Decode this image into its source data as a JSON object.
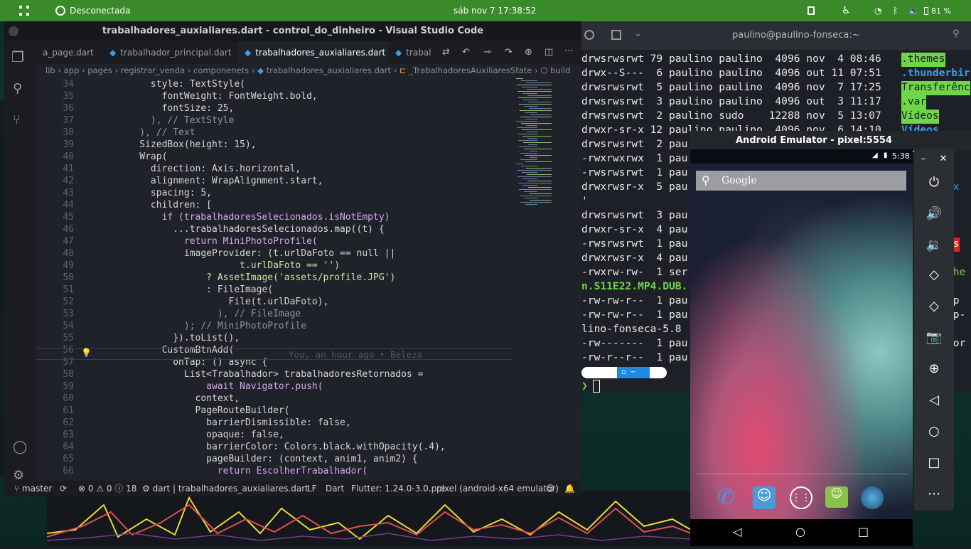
{
  "topbar": {
    "network": "Desconectada",
    "clock": "sáb nov 7  17:38:52",
    "battery": "81 %"
  },
  "vscode": {
    "title": "trabalhadores_auxialiares.dart - control_do_dinheiro - Visual Studio Code",
    "tabs": [
      {
        "label": "a_page.dart"
      },
      {
        "label": "trabalhador_principal.dart"
      },
      {
        "label": "trabalhadores_auxialiares.dart",
        "close": "×"
      },
      {
        "label": "trabal"
      }
    ],
    "breadcrumb": [
      "lib",
      "app",
      "pages",
      "registrar_venda",
      "componenets",
      "trabalhadores_auxialiares.dart",
      "_TrabalhadoresAuxiliaresState",
      "build"
    ],
    "blame": "You, an hour ago • Beleza",
    "status": {
      "branch": "master",
      "problems": "⊗ 0 ⚠ 0 ⓘ 18",
      "lang_file": "dart | trabalhadores_auxialiares.dart",
      "eol": "LF",
      "language": "Dart",
      "flutter": "Flutter: 1.24.0-3.0.pre",
      "device": "pixel (android-x64 emulator)"
    }
  },
  "code_lines": [
    {
      "n": "34",
      "t": "            style: TextStyle("
    },
    {
      "n": "35",
      "t": "              fontWeight: FontWeight.bold,"
    },
    {
      "n": "36",
      "t": "              fontSize: 25,"
    },
    {
      "n": "37",
      "t": "            ), // TextStyle"
    },
    {
      "n": "38",
      "t": "          ), // Text"
    },
    {
      "n": "39",
      "t": "          SizedBox(height: 15),"
    },
    {
      "n": "40",
      "t": "          Wrap("
    },
    {
      "n": "41",
      "t": "            direction: Axis.horizontal,"
    },
    {
      "n": "42",
      "t": "            alignment: WrapAlignment.start,"
    },
    {
      "n": "43",
      "t": "            spacing: 5,"
    },
    {
      "n": "44",
      "t": "            children: ["
    },
    {
      "n": "45",
      "t": "              if (trabalhadoresSelecionados.isNotEmpty)"
    },
    {
      "n": "46",
      "t": "                ...trabalhadoresSelecionados.map((t) {"
    },
    {
      "n": "47",
      "t": "                  return MiniPhotoProfile("
    },
    {
      "n": "48",
      "t": "                  imageProvider: (t.urlDaFoto == null ||"
    },
    {
      "n": "49",
      "t": "                            t.urlDaFoto == '')"
    },
    {
      "n": "50",
      "t": "                      ? AssetImage('assets/profile.JPG')"
    },
    {
      "n": "51",
      "t": "                      : FileImage("
    },
    {
      "n": "52",
      "t": "                          File(t.urlDaFoto),"
    },
    {
      "n": "53",
      "t": "                        ), // FileImage"
    },
    {
      "n": "54",
      "t": "                  ); // MiniPhotoProfile"
    },
    {
      "n": "55",
      "t": "                }).toList(),"
    },
    {
      "n": "56",
      "t": "              CustomBtnAdd("
    },
    {
      "n": "57",
      "t": "                onTap: () async {"
    },
    {
      "n": "58",
      "t": "                  List<Trabalhador> trabalhadoresRetornados ="
    },
    {
      "n": "59",
      "t": "                      await Navigator.push("
    },
    {
      "n": "60",
      "t": "                    context,"
    },
    {
      "n": "61",
      "t": "                    PageRouteBuilder("
    },
    {
      "n": "62",
      "t": "                      barrierDismissible: false,"
    },
    {
      "n": "63",
      "t": "                      opaque: false,"
    },
    {
      "n": "64",
      "t": "                      barrierColor: Colors.black.withOpacity(.4),"
    },
    {
      "n": "65",
      "t": "                      pageBuilder: (context, anim1, anim2) {"
    },
    {
      "n": "66",
      "t": "                        return EscolherTrabalhador("
    }
  ],
  "terminal": {
    "title": "paulino@paulino-fonseca:~",
    "lines": [
      "drwsrwsrwt 79 paulino paulino  4096 nov  4 08:46",
      "drwx--S---  6 paulino paulino  4096 out 11 07:51",
      "drwsrwsrwt  5 paulino paulino  4096 nov  7 17:25",
      "drwsrwsrwt  3 paulino paulino  4096 out  3 11:17",
      "drwsrwsrwt  2 paulino sudo    12288 nov  5 13:07",
      "drwxr-sr-x 12 paulino paulino  4096 nov  6 14:10",
      "drwsrwsrwt  2 pau",
      "-rwxrwxrwx  1 pau",
      "-rwsrwsrwt  1 pau",
      "drwxrwsr-x  5 pau",
      "'",
      "drwsrwsrwt  3 pau",
      "drwxr-sr-x  4 pau",
      "-rwsrwsrwt  1 pau",
      "drwxrwsr-x  4 pau",
      "-rwxrw-rw-  1 ser",
      "n.S11E22.MP4.DUB.",
      "-rw-rw-r--  1 pau",
      "-rw-rw-r--  1 pau",
      "lino-fonseca-5.8",
      "-rw-------  1 pau",
      "-rw-r--r--  1 pau"
    ],
    "right_names": [
      ".themes",
      ".thunderbir",
      "Transferênc",
      ".var",
      "Vídeos",
      "Vídeos",
      "im"
    ],
    "right_frag": [
      "ox",
      "ts",
      "She",
      "mp",
      "mp-",
      "tor"
    ],
    "prompt": "❯"
  },
  "emulator": {
    "title": "Android Emulator - pixel:5554",
    "time": "5:38",
    "search": "Google",
    "controls": [
      "power-icon",
      "volume-up-icon",
      "volume-down-icon",
      "rotate-left-icon",
      "rotate-right-icon",
      "camera-icon",
      "zoom-icon",
      "back-icon",
      "home-icon",
      "overview-icon",
      "more-icon"
    ]
  },
  "colors": {
    "topbar": "#3a8a2a",
    "accent_green": "#6fd64a"
  }
}
